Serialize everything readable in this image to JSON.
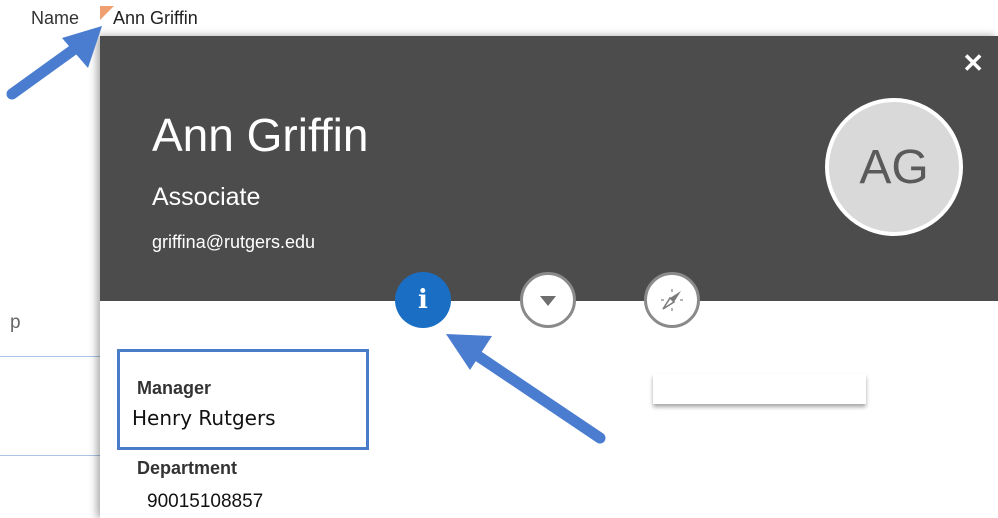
{
  "field": {
    "label": "Name",
    "value": "Ann Griffin"
  },
  "background": {
    "partial_letter": "p"
  },
  "card": {
    "name": "Ann Griffin",
    "title": "Associate",
    "email": "griffina@rutgers.edu",
    "avatar_initials": "AG",
    "close_label": "✕",
    "buttons": {
      "info_glyph": "i",
      "info_icon": "info-icon",
      "dropdown_icon": "chevron-down-icon",
      "compass_icon": "compass-icon"
    },
    "details": {
      "manager_label": "Manager",
      "manager_value": "Henry Rutgers",
      "department_label": "Department",
      "department_value": "90015108857"
    }
  },
  "colors": {
    "header_bg": "#4c4c4c",
    "info_button": "#1a6fc4",
    "highlight_box": "#4a7dc9",
    "arrow": "#4a7dd0"
  }
}
